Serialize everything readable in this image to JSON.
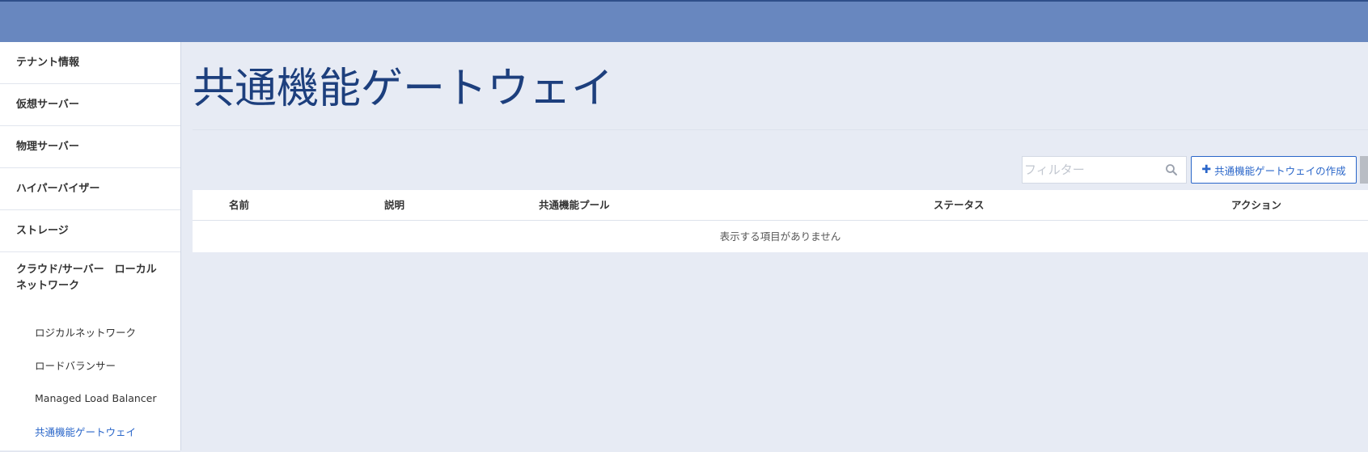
{
  "sidebar": {
    "items": [
      {
        "label": "テナント情報"
      },
      {
        "label": "仮想サーバー"
      },
      {
        "label": "物理サーバー"
      },
      {
        "label": "ハイパーバイザー"
      },
      {
        "label": "ストレージ"
      },
      {
        "label": "クラウド/サーバー　ローカルネットワーク"
      }
    ],
    "subitems": [
      {
        "label": "ロジカルネットワーク"
      },
      {
        "label": "ロードバランサー"
      },
      {
        "label": "Managed Load Balancer"
      },
      {
        "label": "共通機能ゲートウェイ",
        "active": true
      }
    ]
  },
  "main": {
    "title": "共通機能ゲートウェイ",
    "filter_placeholder": "フィルター",
    "create_button_label": "共通機能ゲートウェイの作成",
    "table": {
      "columns": [
        "名前",
        "説明",
        "共通機能プール",
        "ステータス",
        "アクション"
      ],
      "empty_message": "表示する項目がありません"
    }
  },
  "colors": {
    "topbar": "#6887bf",
    "accent": "#2a66c9",
    "title": "#1d3f7d",
    "background": "#e7ebf4"
  },
  "icons": {
    "filter": "search-icon",
    "create": "plus-icon"
  }
}
